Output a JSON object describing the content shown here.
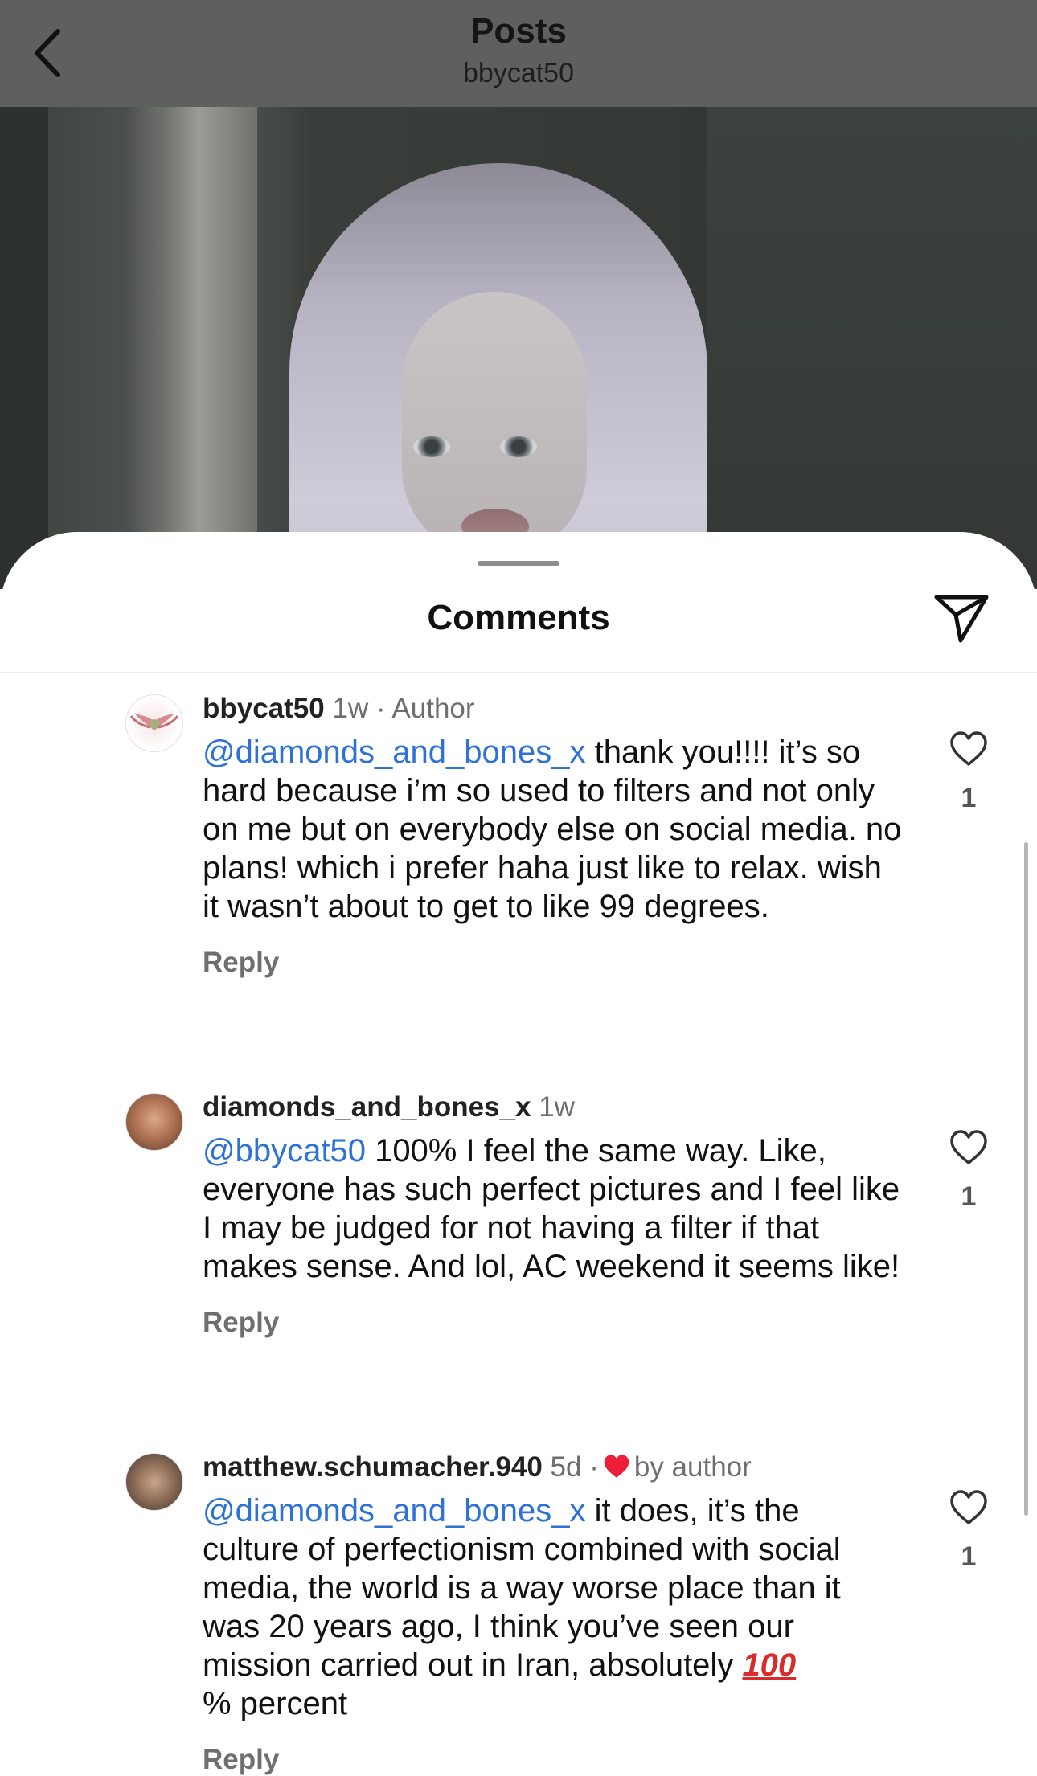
{
  "header": {
    "title": "Posts",
    "subtitle": "bbycat50"
  },
  "sheet": {
    "title": "Comments"
  },
  "colors": {
    "mention": "#2f72d6",
    "liked_heart": "#ee1d3a"
  },
  "comments": [
    {
      "username": "bbycat50",
      "time": "1w",
      "tag": "· Author",
      "mention": "@diamonds_and_bones_x",
      "text": " thank you!!!! it’s so hard because i’m so used to filters and not only on me but on everybody else on social media. no plans! which i prefer haha just like to relax. wish it wasn’t about to get to like 99 degrees.",
      "reply_label": "Reply",
      "likes": "1",
      "avatar_icon": "winged-heart-avatar"
    },
    {
      "username": "diamonds_and_bones_x",
      "time": "1w",
      "tag": "",
      "mention": "@bbycat50",
      "text": " 100% I feel the same way. Like, everyone has such perfect pictures and I feel like I may be judged for not having a filter if that makes sense. And lol, AC weekend it seems like!",
      "reply_label": "Reply",
      "likes": "1",
      "avatar_icon": "user-photo-avatar"
    },
    {
      "username": "matthew.schumacher.940",
      "time": "5d",
      "tag": "by author",
      "mention": "@diamonds_and_bones_x",
      "text": " it does, it’s the culture of perfectionism combined with social media, the world is a way worse place than it was 20 years ago, I think you’ve seen our mission carried out in Iran, absolutely ",
      "emoji": "100",
      "text_end": "% percent",
      "reply_label": "Reply",
      "likes": "1",
      "avatar_icon": "user-photo-avatar"
    }
  ]
}
